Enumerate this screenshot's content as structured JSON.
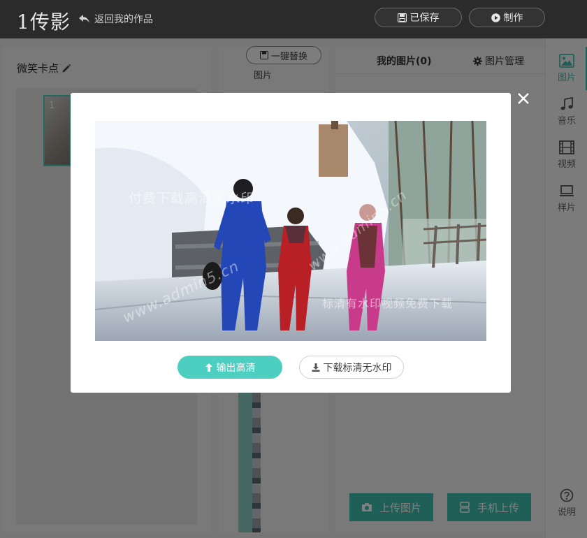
{
  "app": {
    "logo_text": "1传影",
    "back_label": "返回我的作品",
    "saved_label": "已保存",
    "make_label": "制作"
  },
  "left_panel": {
    "project_title": "微笑卡点",
    "slide_number": "1"
  },
  "middle_panel": {
    "replace_label": "一键替换",
    "section_label": "图片"
  },
  "right_panel": {
    "title": "我的图片(0)",
    "manage_label": "图片管理",
    "upload_label": "上传图片",
    "phone_upload_label": "手机上传"
  },
  "side_nav": {
    "items": [
      {
        "label": "图片",
        "icon": "image-icon",
        "active": true
      },
      {
        "label": "音乐",
        "icon": "music-icon",
        "active": false
      },
      {
        "label": "视频",
        "icon": "film-icon",
        "active": false
      },
      {
        "label": "样片",
        "icon": "monitor-icon",
        "active": false
      }
    ],
    "help_label": "说明"
  },
  "modal": {
    "watermark_top": "付费下载高清无水印",
    "watermark_bottom": "标清有水印视频免费下载",
    "watermark_site": "www.admin5.cn",
    "hd_label": "输出高清",
    "sd_label": "下载标清无水印"
  },
  "colors": {
    "accent": "#3dbfae",
    "topbar": "#2b2b2b"
  }
}
